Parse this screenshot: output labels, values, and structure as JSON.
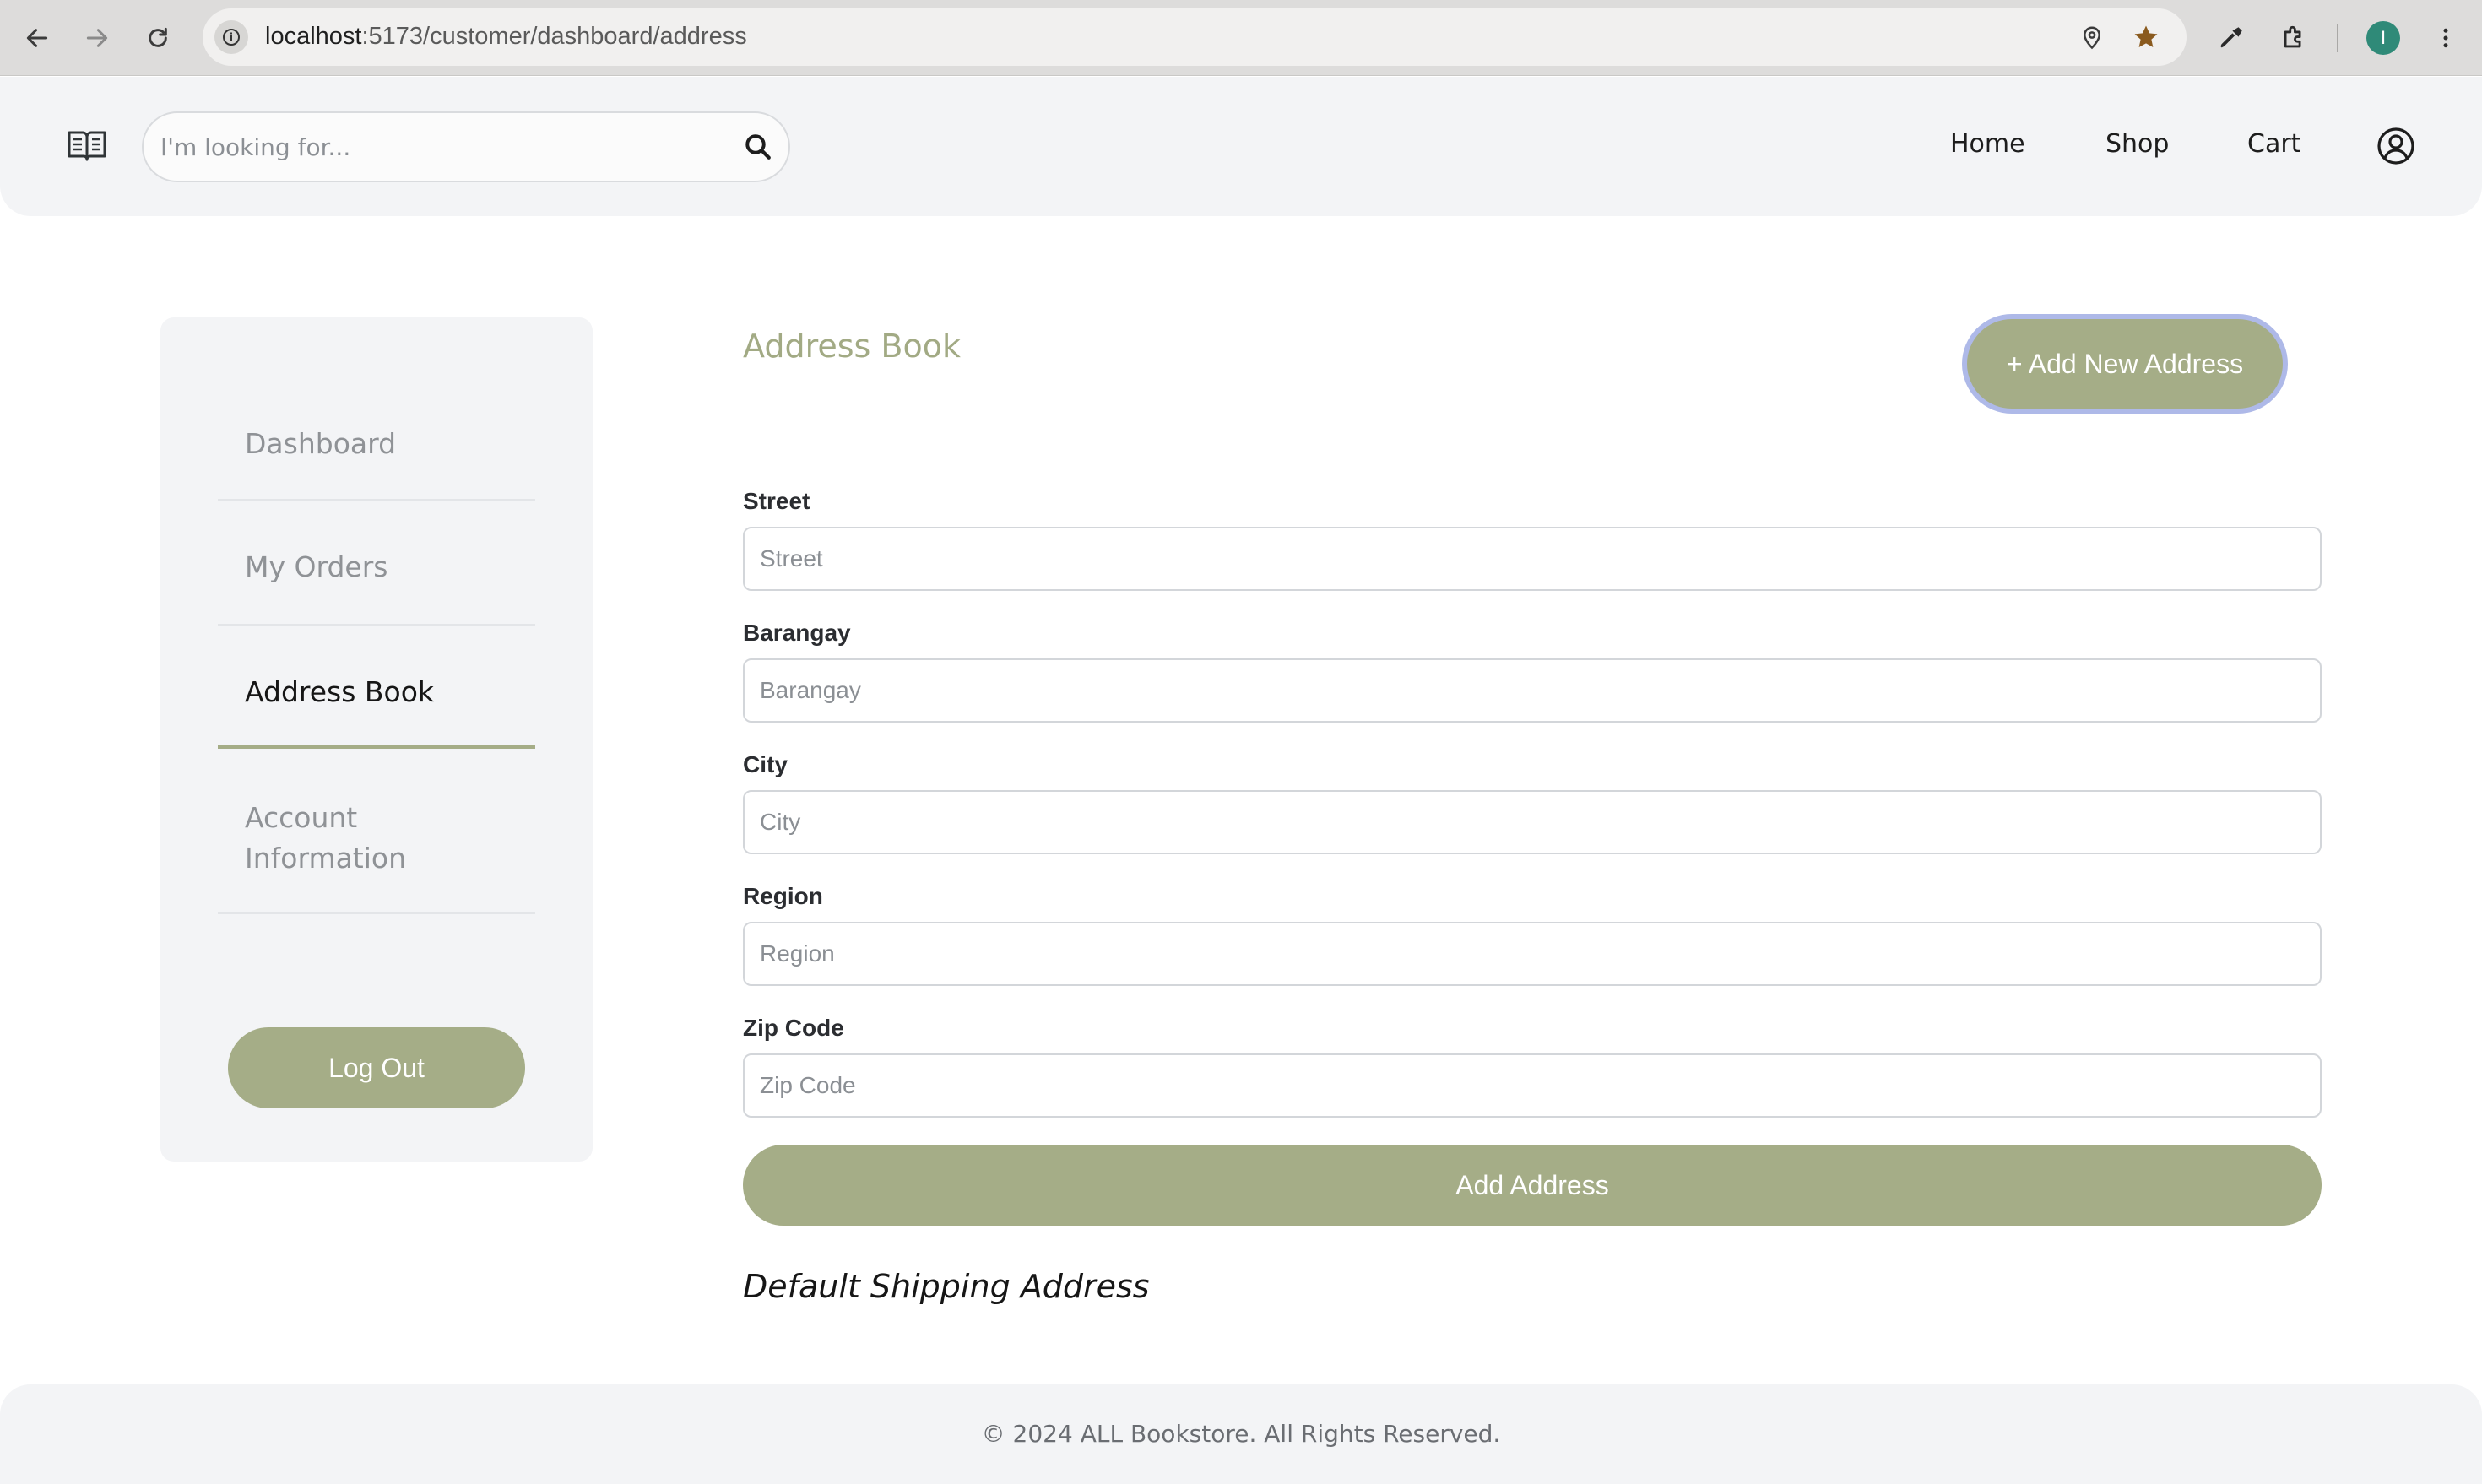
{
  "browser": {
    "url_host": "localhost",
    "url_rest": ":5173/customer/dashboard/address",
    "profile_initial": "I"
  },
  "header": {
    "search_placeholder": "I'm looking for...",
    "nav": [
      "Home",
      "Shop",
      "Cart"
    ]
  },
  "sidebar": {
    "items": [
      {
        "label": "Dashboard",
        "active": false
      },
      {
        "label": "My Orders",
        "active": false
      },
      {
        "label": "Address Book",
        "active": true
      },
      {
        "label": "Account Information",
        "active": false
      }
    ],
    "logout_label": "Log Out"
  },
  "main": {
    "title": "Address Book",
    "add_new_label": "+ Add New Address",
    "fields": [
      {
        "label": "Street",
        "placeholder": "Street",
        "value": ""
      },
      {
        "label": "Barangay",
        "placeholder": "Barangay",
        "value": ""
      },
      {
        "label": "City",
        "placeholder": "City",
        "value": ""
      },
      {
        "label": "Region",
        "placeholder": "Region",
        "value": ""
      },
      {
        "label": "Zip Code",
        "placeholder": "Zip Code",
        "value": ""
      }
    ],
    "submit_label": "Add Address",
    "default_shipping_heading": "Default Shipping Address"
  },
  "footer": {
    "copyright": "© 2024 ALL Bookstore. All Rights Reserved."
  },
  "colors": {
    "accent": "#a5ad87",
    "title": "#a2aa84",
    "panel": "#f3f4f6"
  }
}
